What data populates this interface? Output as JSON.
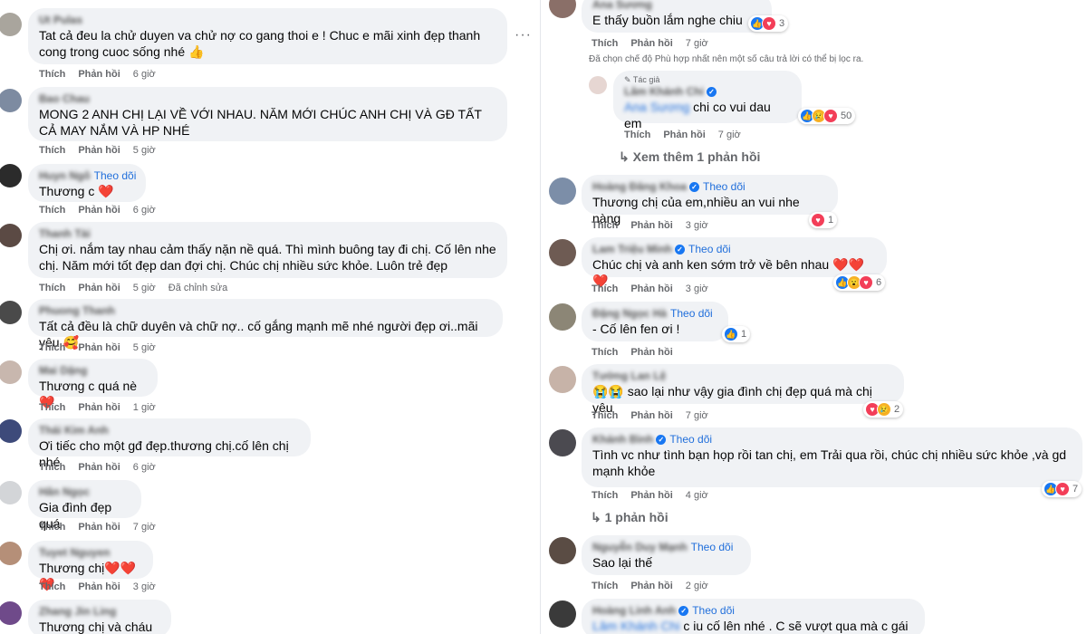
{
  "left": [
    {
      "name": "Ut Pulas",
      "text": "Tat cả đeu la chử duyen va chử nợ co gang thoi e ! Chuc e mãi xinh đẹp thanh cong trong cuoc sống nhé 👍",
      "time": "6 giờ",
      "follow": ""
    },
    {
      "name": "Bao Chau",
      "text": "MONG 2 ANH CHỊ LẠI VỀ VỚI NHAU. NĂM MỚI CHÚC ANH CHỊ VÀ GĐ TẤT CẢ MAY NẮM VÀ HP NHÉ",
      "time": "5 giờ",
      "follow": ""
    },
    {
      "name": "Huyn Ngô",
      "text": "Thương c ❤️",
      "time": "6 giờ",
      "follow": "Theo dõi"
    },
    {
      "name": "Thanh Tài",
      "text": "Chị ơi. nắm tay nhau cảm thấy nặn nề quá. Thì mình buông tay đi chị. Cố lên nhe chị. Năm mới tốt đẹp dan đợi chị. Chúc chị nhiều sức khỏe. Luôn trẻ đẹp",
      "time": "5 giờ",
      "follow": "",
      "edited": "Đã chỉnh sửa"
    },
    {
      "name": "Phuong Thanh",
      "text": "Tất cả đều là chữ duyên và chữ nợ.. cố gắng mạnh mẽ nhé người đẹp ơi..mãi yêu 🥰",
      "time": "5 giờ",
      "follow": ""
    },
    {
      "name": "Mai Dặng",
      "text": "Thương c quá nè ❤️",
      "time": "1 giờ",
      "follow": ""
    },
    {
      "name": "Thái Kim Anh",
      "text": "Ơi tiếc cho một gđ đẹp.thương chị.cố lên chị nhé",
      "time": "6 giờ",
      "follow": ""
    },
    {
      "name": "Hân Ngọc",
      "text": "Gia đình đẹp quá",
      "time": "7 giờ",
      "follow": ""
    },
    {
      "name": "Tuyet Nguyen",
      "text": "Thương chị❤️❤️❤️",
      "time": "3 giờ",
      "follow": ""
    },
    {
      "name": "Zhang Jin Ling",
      "text": "Thương chị và cháu 😨",
      "time": "",
      "follow": ""
    }
  ],
  "right": {
    "top": {
      "name": "Ana Sương",
      "text": "E thấy buồn lắm nghe chiu",
      "time": "7 giờ",
      "reacts": "3"
    },
    "filter_note": "Đã chọn chế độ Phù hợp nhất nên một số câu trả lời có thể bị lọc ra.",
    "author_reply": {
      "tag": "Tác giả",
      "name": "Lâm Khánh Chi",
      "mention": "Ana Sương",
      "text": "chi co vui dau em",
      "time": "7 giờ",
      "reacts": "50"
    },
    "more_replies": "Xem thêm 1 phản hồi",
    "items": [
      {
        "name": "Hoàng Đăng Khoa",
        "follow": "Theo dõi",
        "text": "Thương chị của em,nhiều an vui nhe nàng",
        "time": "3 giờ",
        "reacts": "1"
      },
      {
        "name": "Lam Triệu Minh",
        "follow": "Theo dõi",
        "text": "Chúc chị và anh ken sớm trở về bên nhau ❤️❤️❤️",
        "time": "3 giờ",
        "reacts": "6"
      },
      {
        "name": "Đặng Ngọc Hà",
        "follow": "Theo dõi",
        "text": "- Cố lên fen ơi !",
        "time": "",
        "reacts": "1"
      },
      {
        "name": "Tường Lan Lệ",
        "follow": "",
        "text": "😭😭 sao lại như vậy gia đình chị đẹp quá mà chị yêu",
        "time": "7 giờ",
        "reacts": "2"
      },
      {
        "name": "Khánh Bình",
        "follow": "Theo dõi",
        "text": "Tình vc như tình bạn họp rồi tan chị, em Trải qua rồi, chúc chị nhiều sức khỏe ,và gd mạnh khỏe",
        "time": "4 giờ",
        "reacts": "7"
      },
      {
        "name": "Nguyễn Duy Mạnh",
        "follow": "Theo dõi",
        "text": "Sao lại thế",
        "time": "2 giờ",
        "reacts": ""
      },
      {
        "name": "Hoàng Linh Anh",
        "follow": "Theo dõi",
        "mention": "Lâm Khánh Chi",
        "text": "c iu cố lên nhé . C sẽ vượt qua mà c gái e",
        "time": "",
        "reacts": ""
      }
    ],
    "one_reply": "1 phản hồi"
  },
  "labels": {
    "like": "Thích",
    "reply": "Phản hồi"
  },
  "icons": [
    "more-dots-icon",
    "like-reaction-icon",
    "love-reaction-icon",
    "sad-reaction-icon",
    "care-reaction-icon",
    "verified-badge-icon",
    "reply-arrow-icon",
    "pencil-icon"
  ],
  "colors": {
    "bubble": "#f0f2f5",
    "link": "#216fdb",
    "meta": "#65676b",
    "like": "#1877f2",
    "love": "#f33e58"
  }
}
